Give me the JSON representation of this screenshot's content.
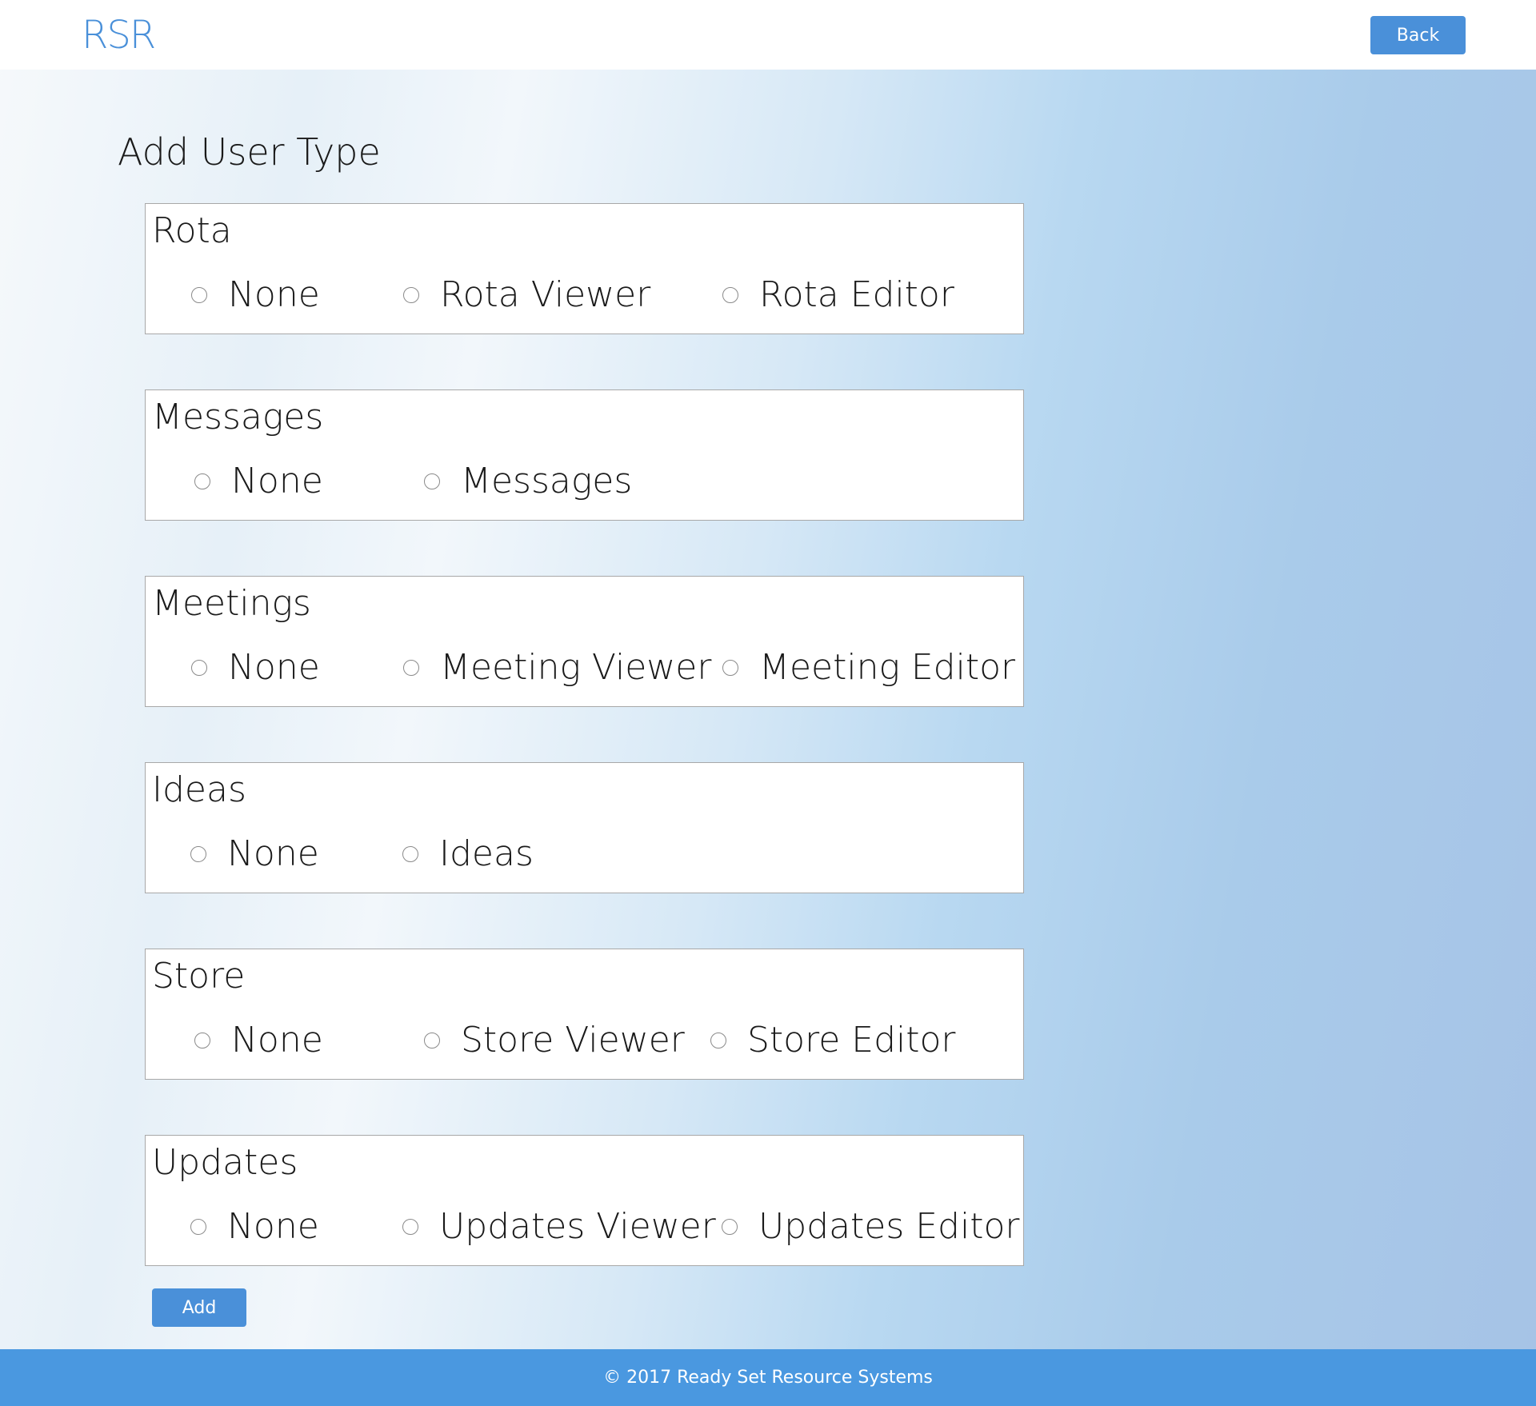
{
  "header": {
    "logo": "RSR",
    "back_label": "Back"
  },
  "page_title": "Add User Type",
  "sections": [
    {
      "title": "Rota",
      "options": [
        {
          "label": "None",
          "selected": false
        },
        {
          "label": "Rota Viewer",
          "selected": false
        },
        {
          "label": "Rota Editor",
          "selected": false
        }
      ]
    },
    {
      "title": "Messages",
      "options": [
        {
          "label": "None",
          "selected": false
        },
        {
          "label": "Messages",
          "selected": false
        }
      ]
    },
    {
      "title": "Meetings",
      "options": [
        {
          "label": "None",
          "selected": false
        },
        {
          "label": "Meeting Viewer",
          "selected": false
        },
        {
          "label": "Meeting Editor",
          "selected": false
        }
      ]
    },
    {
      "title": "Ideas",
      "options": [
        {
          "label": "None",
          "selected": false
        },
        {
          "label": "Ideas",
          "selected": false
        }
      ]
    },
    {
      "title": "Store",
      "options": [
        {
          "label": "None",
          "selected": false
        },
        {
          "label": "Store Viewer",
          "selected": false
        },
        {
          "label": "Store Editor",
          "selected": false
        }
      ]
    },
    {
      "title": "Updates",
      "options": [
        {
          "label": "None",
          "selected": false
        },
        {
          "label": "Updates Viewer",
          "selected": false
        },
        {
          "label": "Updates Editor",
          "selected": false
        }
      ]
    }
  ],
  "add_label": "Add",
  "footer": {
    "copyright": "© 2017 Ready Set Resource Systems"
  },
  "colors": {
    "accent": "#4a90d9",
    "footer_bg": "#4a98e0"
  }
}
